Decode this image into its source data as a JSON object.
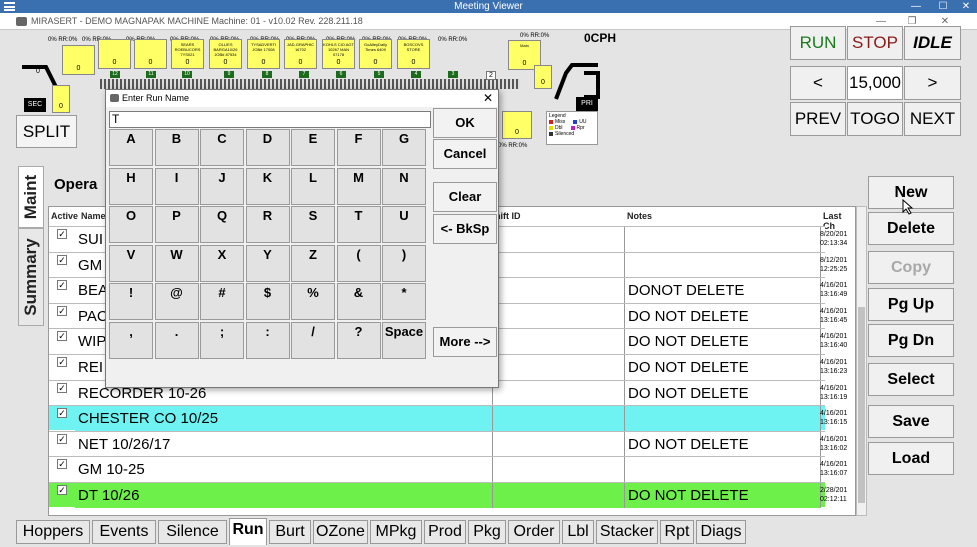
{
  "meeting_viewer": {
    "title": "Meeting Viewer",
    "controls": [
      "—",
      "☐",
      "✕"
    ]
  },
  "app": {
    "title": "MIRASERT - DEMO MAGNAPAK   MACHINE Machine: 01 - v10.02 Rev. 228.211.18",
    "controls": [
      "—",
      "❐",
      "✕"
    ]
  },
  "diagram": {
    "cph": "0CPH",
    "sec_label": "SEC",
    "pri_label": "PRI",
    "counters": {
      "left": "0",
      "left2": "0",
      "right": "0"
    },
    "hopper_headers": [
      "0% RR:0%",
      "0% RR:0%",
      "0% RR:0%",
      "0% RR:0%",
      "0% RR:0%",
      "0% RR:0%",
      "0% RR:0%",
      "0% RR:0%",
      "0% RR:0%",
      "0% RR:0%",
      "0% RR:0%",
      "0% RR:0%"
    ],
    "hoppers": [
      {
        "name": "",
        "value": "0",
        "num": "12"
      },
      {
        "name": "",
        "value": "0",
        "num": "11"
      },
      {
        "name": "",
        "value": "0",
        "num": "10"
      },
      {
        "name": "SEARS ROEBUCORS 7YS021",
        "value": "0",
        "num": "9"
      },
      {
        "name": "OLLIES BARGA10/26 JOB# 87534",
        "value": "0",
        "num": "8"
      },
      {
        "name": "TYSADVERTI JOB# 17008",
        "value": "0",
        "num": "7"
      },
      {
        "name": "JAD-GRAPHIC 16702",
        "value": "0",
        "num": "6"
      },
      {
        "name": "KOHLS CIO AGT 10267 MAN 07178",
        "value": "0",
        "num": "5"
      },
      {
        "name": "GoAlleyDaily Times 6409",
        "value": "0",
        "num": "4"
      },
      {
        "name": "BOSCOVS STORE",
        "value": "0",
        "num": "3"
      },
      {
        "name": "Main",
        "value": "0",
        "num": "1"
      }
    ],
    "small_hopper_value": "0",
    "bottom_header": "0% RR:0%",
    "bottom_header2": "0% RR:0%",
    "rail_num": "2",
    "legend": {
      "title": "Legend",
      "items": [
        {
          "label": "Miss",
          "color": "#d62020"
        },
        {
          "label": "UU",
          "color": "#2040d0"
        },
        {
          "label": "Dbl",
          "color": "#e0e000"
        },
        {
          "label": "Rpr",
          "color": "#c020c0"
        },
        {
          "label": "Silenced",
          "color": "#333333"
        }
      ]
    },
    "split_label": "SPLIT"
  },
  "controls": {
    "run": "RUN",
    "stop": "STOP",
    "idle": "IDLE",
    "left_arrow": "<",
    "right_arrow": ">",
    "count": "15,000",
    "prev": "PREV",
    "togo": "TOGO",
    "next": "NEXT",
    "colors": {
      "run": "#1c7a1c",
      "stop": "#8b1a1a"
    }
  },
  "side_tabs": {
    "maint": "Maint",
    "summary": "Summary"
  },
  "operator": {
    "label": "Opera"
  },
  "grid": {
    "headers": {
      "active": "Active",
      "name": "Name",
      "shift_id": "hift ID",
      "notes": "Notes",
      "last_change": "Last Ch"
    },
    "rows": [
      {
        "checked": "✓",
        "name": "SUI",
        "notes": "",
        "date": "8/20/201",
        "time": "02:13:34",
        "bg": "#ffffff"
      },
      {
        "checked": "✓",
        "name": "GM",
        "notes": "",
        "date": "8/12/201",
        "time": "12:25:25",
        "bg": "#ffffff"
      },
      {
        "checked": "✓",
        "name": "BEA",
        "notes": "DONOT DELETE",
        "date": "4/16/201",
        "time": "13:16:49",
        "bg": "#ffffff"
      },
      {
        "checked": "✓",
        "name": "PAC",
        "notes": "DO NOT DELETE",
        "date": "4/16/201",
        "time": "13:16:45",
        "bg": "#ffffff"
      },
      {
        "checked": "✓",
        "name": "WIP",
        "notes": "DO NOT DELETE",
        "date": "4/16/201",
        "time": "13:16:40",
        "bg": "#ffffff"
      },
      {
        "checked": "✓",
        "name": "REI",
        "notes": "DO NOT DELETE",
        "date": "4/16/201",
        "time": "13:16:23",
        "bg": "#ffffff"
      },
      {
        "checked": "✓",
        "name": "RECORDER 10-26",
        "notes": "DO NOT DELETE",
        "date": "4/16/201",
        "time": "13:16:19",
        "bg": "#ffffff"
      },
      {
        "checked": "✓",
        "name": "CHESTER CO 10/25",
        "notes": "",
        "date": "4/16/201",
        "time": "13:16:15",
        "bg": "#6ff2f2"
      },
      {
        "checked": "✓",
        "name": "NET 10/26/17",
        "notes": "DO NOT DELETE",
        "date": "4/16/201",
        "time": "13:16:02",
        "bg": "#ffffff"
      },
      {
        "checked": "✓",
        "name": "GM  10-25",
        "notes": "",
        "date": "4/16/201",
        "time": "13:16:07",
        "bg": "#ffffff"
      },
      {
        "checked": "✓",
        "name": "DT 10/26",
        "notes": "DO NOT DELETE",
        "date": "2/28/201",
        "time": "02:12:11",
        "bg": "#6ef04a"
      }
    ]
  },
  "actions": {
    "new": "New",
    "delete": "Delete",
    "copy": "Copy",
    "pg_up": "Pg Up",
    "pg_dn": "Pg Dn",
    "select": "Select",
    "save": "Save",
    "load": "Load"
  },
  "bottom_tabs": [
    "Hoppers",
    "Events",
    "Silence",
    "Run",
    "Burt",
    "OZone",
    "MPkg",
    "Prod",
    "Pkg",
    "Order",
    "Lbl",
    "Stacker",
    "Rpt",
    "Diags"
  ],
  "active_tab": "Run",
  "dialog": {
    "title": "Enter Run Name",
    "close": "✕",
    "input_value": "T",
    "keys": [
      [
        "A",
        "B",
        "C",
        "D",
        "E",
        "F",
        "G"
      ],
      [
        "H",
        "I",
        "J",
        "K",
        "L",
        "M",
        "N"
      ],
      [
        "O",
        "P",
        "Q",
        "R",
        "S",
        "T",
        "U"
      ],
      [
        "V",
        "W",
        "X",
        "Y",
        "Z",
        "(",
        ")"
      ],
      [
        "!",
        "@",
        "#",
        "$",
        "%",
        "&",
        "*"
      ],
      [
        ",",
        ".",
        ";",
        ":",
        "/",
        "?",
        "Space"
      ]
    ],
    "ok": "OK",
    "cancel": "Cancel",
    "clear": "Clear",
    "backspace": "<- BkSp",
    "more": "More -->"
  }
}
